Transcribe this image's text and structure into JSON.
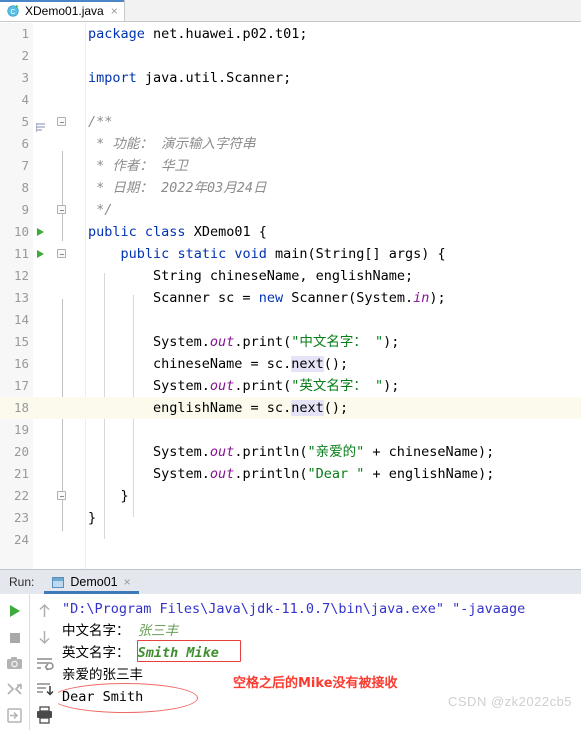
{
  "editor_tab": {
    "icon": "java-class-icon",
    "label": "XDemo01.java",
    "close": "×"
  },
  "editor": {
    "lines": [
      {
        "n": "1",
        "html": "<span class=\"kw\">package</span> net.huawei.p02.t01;"
      },
      {
        "n": "2",
        "html": ""
      },
      {
        "n": "3",
        "html": "<span class=\"kw\">import</span> java.util.Scanner;"
      },
      {
        "n": "4",
        "html": ""
      },
      {
        "n": "5",
        "html": "<span class=\"cmt\">/**</span>"
      },
      {
        "n": "6",
        "html": "<span class=\"cmt\"> * 功能： 演示输入字符串</span>"
      },
      {
        "n": "7",
        "html": "<span class=\"cmt\"> * 作者： 华卫</span>"
      },
      {
        "n": "8",
        "html": "<span class=\"cmt\"> * 日期： 2022年03月24日</span>"
      },
      {
        "n": "9",
        "html": "<span class=\"cmt\"> */</span>"
      },
      {
        "n": "10",
        "html": "<span class=\"kw\">public</span> <span class=\"kw\">class</span> XDemo01 {"
      },
      {
        "n": "11",
        "html": "    <span class=\"kw\">public</span> <span class=\"kw\">static</span> <span class=\"kw\">void</span> main(String[] args) {"
      },
      {
        "n": "12",
        "html": "        String chineseName, englishName;"
      },
      {
        "n": "13",
        "html": "        Scanner sc = <span class=\"kw\">new</span> Scanner(System.<span class=\"fld\">in</span>);"
      },
      {
        "n": "14",
        "html": ""
      },
      {
        "n": "15",
        "html": "        System.<span class=\"fld\">out</span>.print(<span class=\"str\">\"中文名字： \"</span>);"
      },
      {
        "n": "16",
        "html": "        chineseName = sc.<span class=\"hlid\">next</span>();"
      },
      {
        "n": "17",
        "html": "        System.<span class=\"fld\">out</span>.print(<span class=\"str\">\"英文名字： \"</span>);"
      },
      {
        "n": "18",
        "html": "        englishName = sc.<span class=\"hlid\">next</span>();"
      },
      {
        "n": "19",
        "html": ""
      },
      {
        "n": "20",
        "html": "        System.<span class=\"fld\">out</span>.println(<span class=\"str\">\"亲爱的\"</span> + chineseName);"
      },
      {
        "n": "21",
        "html": "        System.<span class=\"fld\">out</span>.println(<span class=\"str\">\"Dear \"</span> + englishName);"
      },
      {
        "n": "22",
        "html": "    }"
      },
      {
        "n": "23",
        "html": "}"
      },
      {
        "n": "24",
        "html": ""
      }
    ],
    "highlighted_line": "18",
    "run_gutter_lines": [
      "10",
      "11"
    ]
  },
  "run_window": {
    "label": "Run:",
    "tab": {
      "label": "Demo01",
      "close": "×",
      "icon": "console-icon"
    },
    "toolbar": {
      "left": [
        {
          "name": "rerun-button",
          "icon": "play-icon"
        },
        {
          "name": "stop-button",
          "icon": "stop-icon"
        },
        {
          "name": "screenshot-button",
          "icon": "camera-icon"
        },
        {
          "name": "restore-layout-button",
          "icon": "layout-icon"
        },
        {
          "name": "export-button",
          "icon": "export-icon"
        }
      ],
      "right": [
        {
          "name": "up-button",
          "icon": "arrow-up-icon"
        },
        {
          "name": "down-button",
          "icon": "arrow-down-icon"
        },
        {
          "name": "soft-wrap-button",
          "icon": "wrap-icon"
        },
        {
          "name": "scroll-to-end-button",
          "icon": "scroll-end-icon"
        },
        {
          "name": "print-button",
          "icon": "printer-icon"
        }
      ]
    },
    "console": [
      {
        "html": "<span class=\"cmd\">\"D:\\Program Files\\Java\\jdk-11.0.7\\bin\\java.exe\" \"-javaage</span>"
      },
      {
        "html": "中文名字： <span class=\"inp\">张三丰</span>"
      },
      {
        "html": "英文名字： <span class=\"inp2\">Smith Mike</span>"
      },
      {
        "html": "亲爱的张三丰"
      },
      {
        "html": "Dear Smith"
      }
    ]
  },
  "annotations": {
    "note": "空格之后的Mike没有被接收",
    "note_color": "#fb3b30",
    "watermark": "CSDN @zk2022cb5",
    "box_color": "#e8403a",
    "ellipse_color": "#ee6a66"
  }
}
